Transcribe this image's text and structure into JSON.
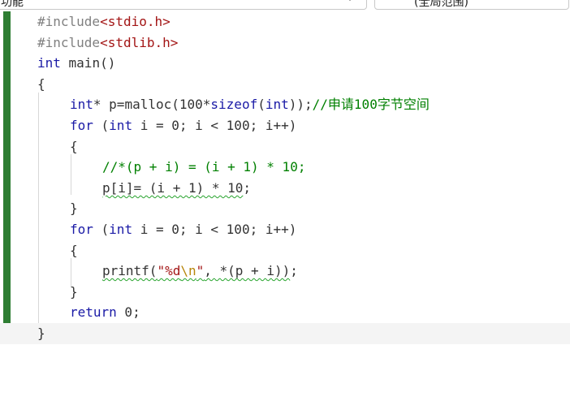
{
  "toolbar": {
    "left_combo_text": "(全局范围)",
    "left_combo_partial": "功能",
    "right_combo_text": "(全局范围)"
  },
  "code": {
    "lines": [
      {
        "segments": [
          {
            "t": "#include",
            "c": "pre"
          },
          {
            "t": "<stdio.h>",
            "c": "inc"
          }
        ]
      },
      {
        "segments": [
          {
            "t": "#include",
            "c": "pre"
          },
          {
            "t": "<stdlib.h>",
            "c": "inc"
          }
        ]
      },
      {
        "segments": [
          {
            "t": "int",
            "c": "kw"
          },
          {
            "t": " main()",
            "c": "id"
          }
        ]
      },
      {
        "segments": [
          {
            "t": "{",
            "c": "op"
          }
        ]
      },
      {
        "segments": [
          {
            "t": "int",
            "c": "kw"
          },
          {
            "t": "* p=malloc(100*",
            "c": "id"
          },
          {
            "t": "sizeof",
            "c": "kw"
          },
          {
            "t": "(",
            "c": "op"
          },
          {
            "t": "int",
            "c": "kw"
          },
          {
            "t": "));",
            "c": "op"
          },
          {
            "t": "//申请100字节空间",
            "c": "cm"
          }
        ]
      },
      {
        "segments": [
          {
            "t": "for",
            "c": "kw"
          },
          {
            "t": " (",
            "c": "op"
          },
          {
            "t": "int",
            "c": "kw"
          },
          {
            "t": " i = 0; i < 100; i++)",
            "c": "id"
          }
        ]
      },
      {
        "segments": [
          {
            "t": "{",
            "c": "op"
          }
        ]
      },
      {
        "segments": [
          {
            "t": "//*(p + i) = (i + 1) * 10;",
            "c": "cm"
          }
        ]
      },
      {
        "segments": [
          {
            "t": "p[i]= (i + 1) * 10",
            "c": "id",
            "squig": true
          },
          {
            "t": ";",
            "c": "op"
          }
        ]
      },
      {
        "segments": [
          {
            "t": "}",
            "c": "op"
          }
        ]
      },
      {
        "segments": [
          {
            "t": "for",
            "c": "kw"
          },
          {
            "t": " (",
            "c": "op"
          },
          {
            "t": "int",
            "c": "kw"
          },
          {
            "t": " i = 0; i < 100; i++)",
            "c": "id"
          }
        ]
      },
      {
        "segments": [
          {
            "t": "{",
            "c": "op"
          }
        ]
      },
      {
        "segments": [
          {
            "t": "printf(",
            "c": "id",
            "squig": true
          },
          {
            "t": "\"%d",
            "c": "str",
            "squig": true
          },
          {
            "t": "\\n",
            "c": "esc",
            "squig": true
          },
          {
            "t": "\"",
            "c": "str",
            "squig": true
          },
          {
            "t": ", *(p + i))",
            "c": "id",
            "squig": true
          },
          {
            "t": ";",
            "c": "op"
          }
        ]
      },
      {
        "segments": [
          {
            "t": "}",
            "c": "op"
          }
        ]
      },
      {
        "segments": [
          {
            "t": "return",
            "c": "kw"
          },
          {
            "t": " 0;",
            "c": "id"
          }
        ]
      },
      {
        "segments": [
          {
            "t": "}",
            "c": "op"
          }
        ]
      }
    ]
  }
}
